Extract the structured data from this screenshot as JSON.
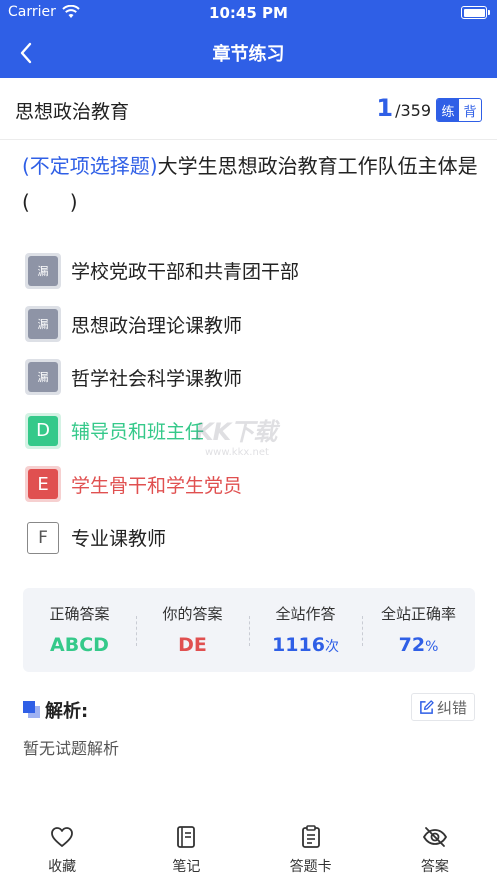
{
  "status_bar": {
    "carrier": "Carrier",
    "time": "10:45 PM"
  },
  "nav": {
    "title": "章节练习"
  },
  "subject": {
    "name": "思想政治教育",
    "current": "1",
    "total": "/359",
    "mode_practice": "练",
    "mode_memorize": "背"
  },
  "question": {
    "type": "(不定项选择题)",
    "text": "大学生思想政治教育工作队伍主体是(　　)"
  },
  "options": [
    {
      "badge": "漏",
      "text": "学校党政干部和共青团干部",
      "state": "missed"
    },
    {
      "badge": "漏",
      "text": "思想政治理论课教师",
      "state": "missed"
    },
    {
      "badge": "漏",
      "text": "哲学社会科学课教师",
      "state": "missed"
    },
    {
      "badge": "D",
      "text": "辅导员和班主任",
      "state": "correct"
    },
    {
      "badge": "E",
      "text": "学生骨干和学生党员",
      "state": "wrong"
    },
    {
      "badge": "F",
      "text": "专业课教师",
      "state": "plain"
    }
  ],
  "watermark": {
    "main": "KK下载",
    "url": "www.kkx.net"
  },
  "stats": {
    "correct_label": "正确答案",
    "correct_value": "ABCD",
    "yours_label": "你的答案",
    "yours_value": "DE",
    "attempts_label": "全站作答",
    "attempts_value": "1116",
    "attempts_unit": "次",
    "rate_label": "全站正确率",
    "rate_value": "72",
    "rate_unit": "%"
  },
  "analysis": {
    "title": "解析:",
    "report_label": "纠错",
    "body": "暂无试题解析"
  },
  "tabbar": {
    "favorite": "收藏",
    "notes": "笔记",
    "answer_card": "答题卡",
    "answer": "答案"
  },
  "colors": {
    "primary": "#2f5fe6",
    "correct": "#35c98a",
    "wrong": "#e05050",
    "missed": "#8e94a6"
  }
}
